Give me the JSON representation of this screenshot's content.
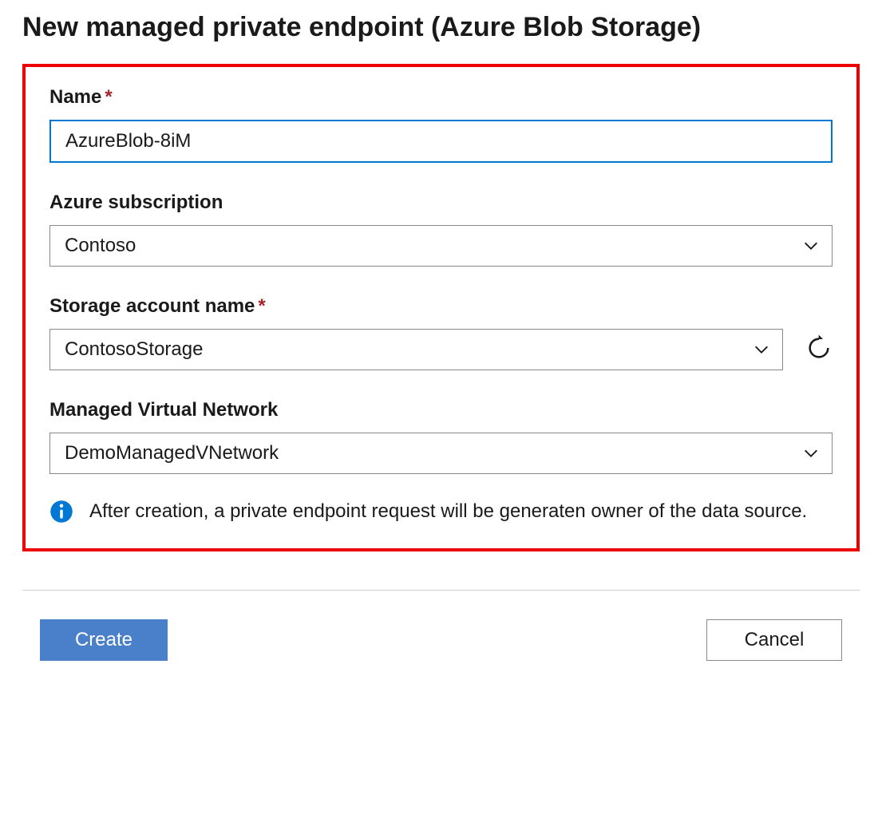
{
  "header": {
    "title": "New managed private endpoint (Azure Blob Storage)"
  },
  "form": {
    "name": {
      "label": "Name",
      "required": true,
      "value": "AzureBlob-8iM"
    },
    "subscription": {
      "label": "Azure subscription",
      "required": false,
      "value": "Contoso"
    },
    "storage_account": {
      "label": "Storage account name",
      "required": true,
      "value": "ContosoStorage"
    },
    "managed_vnet": {
      "label": "Managed Virtual Network",
      "required": false,
      "value": "DemoManagedVNetwork"
    },
    "info_message": "After creation, a private endpoint request will be generaten owner of the data source."
  },
  "footer": {
    "create_label": "Create",
    "cancel_label": "Cancel"
  },
  "colors": {
    "highlight_border": "#ef0000",
    "primary": "#0078d4",
    "button_primary_bg": "#4a7fc9",
    "info_icon": "#0078d4",
    "required": "#a4262c"
  }
}
